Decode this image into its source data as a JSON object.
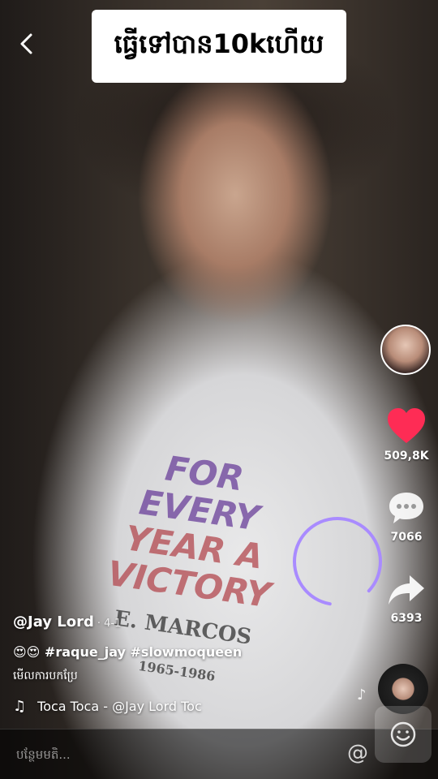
{
  "top_caption": "ធ្វើទៅបាន10kហើយ",
  "actions": {
    "likes": "509,8K",
    "comments": "7066",
    "shares": "6393"
  },
  "post": {
    "username": "@Jay Lord",
    "date": "· 4-1",
    "description": "😍😍 #raque_jay #slowmoqueen",
    "translate": "មើលការបកប្រែ",
    "music": "Toca Toca - @Jay Lord    Toc"
  },
  "comment_bar": {
    "placeholder": "បន្ថែមមតិ..."
  },
  "shirt_print": {
    "line1": "FOR EVERY",
    "line2": "YEAR A",
    "line3": "VICTORY",
    "line4": "E. MARCOS",
    "line5": "1965-1986"
  },
  "colors": {
    "like": "#fe2c55",
    "ring": "#a98bff"
  }
}
